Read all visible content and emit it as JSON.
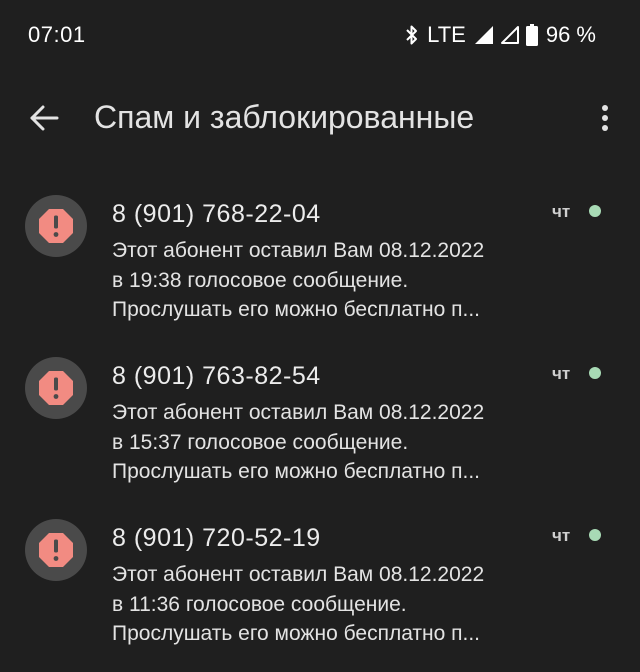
{
  "status_bar": {
    "time": "07:01",
    "network": "LTE",
    "battery": "96 %",
    "icons": [
      "bluetooth-icon",
      "signal-icon",
      "signal-icon-2",
      "battery-icon"
    ]
  },
  "app_bar": {
    "title": "Спам и заблокированные",
    "back_icon": "arrow-back-icon",
    "more_icon": "more-vert-icon"
  },
  "colors": {
    "background": "#1f1f1f",
    "avatar_bg": "#4a4a4a",
    "spam_icon": "#f28b82",
    "unread_dot": "#a8dab5"
  },
  "messages": [
    {
      "sender": "8 (901) 768-22-04",
      "preview_lines": [
        "Этот абонент оставил Вам 08.12.2022",
        "в 19:38 голосовое сообщение.",
        "Прослушать его можно бесплатно п..."
      ],
      "time": "чт",
      "unread": true
    },
    {
      "sender": "8 (901) 763-82-54",
      "preview_lines": [
        "Этот абонент оставил Вам 08.12.2022",
        "в 15:37 голосовое сообщение.",
        "Прослушать его можно бесплатно п..."
      ],
      "time": "чт",
      "unread": true
    },
    {
      "sender": "8 (901) 720-52-19",
      "preview_lines": [
        "Этот абонент оставил Вам 08.12.2022",
        "в 11:36 голосовое сообщение.",
        "Прослушать его можно бесплатно п..."
      ],
      "time": "чт",
      "unread": true
    }
  ]
}
